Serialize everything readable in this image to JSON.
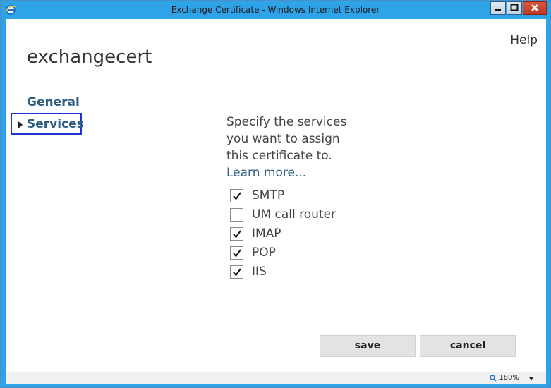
{
  "window": {
    "title": "Exchange Certificate - Windows Internet Explorer"
  },
  "header": {
    "help_label": "Help"
  },
  "page": {
    "title": "exchangecert"
  },
  "nav": {
    "items": [
      {
        "label": "General"
      },
      {
        "label": "Services"
      }
    ],
    "selected": "Services"
  },
  "main": {
    "description": "Specify the services you want to assign this certificate to.",
    "learn_more": "Learn more...",
    "services": [
      {
        "label": "SMTP",
        "checked": true
      },
      {
        "label": "UM call router",
        "checked": false
      },
      {
        "label": "IMAP",
        "checked": true
      },
      {
        "label": "POP",
        "checked": true
      },
      {
        "label": "IIS",
        "checked": true
      }
    ]
  },
  "buttons": {
    "save_label": "save",
    "cancel_label": "cancel"
  },
  "status": {
    "zoom": "180%"
  },
  "icons": {
    "browser": "ie-icon",
    "zoom": "zoom-icon"
  },
  "colors": {
    "accent": "#2e5f82",
    "selection_border": "#1f35d1",
    "titlebar": "#2fa3e8"
  }
}
